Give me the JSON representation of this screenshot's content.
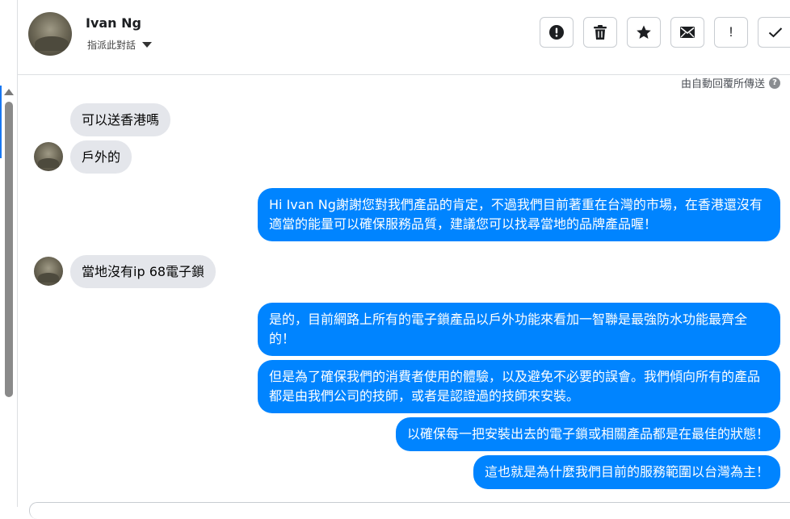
{
  "header": {
    "contact_name": "Ivan Ng",
    "assign_label": "指派此對話",
    "toolbar": [
      {
        "name": "spam-button",
        "icon": "alert-circle-icon"
      },
      {
        "name": "delete-button",
        "icon": "trash-icon"
      },
      {
        "name": "star-button",
        "icon": "star-icon"
      },
      {
        "name": "mark-unread-button",
        "icon": "envelope-icon"
      },
      {
        "name": "follow-up-button",
        "icon": "exclamation-icon",
        "label": "!"
      },
      {
        "name": "done-button",
        "icon": "check-icon"
      }
    ]
  },
  "auto_reply_note": "由自動回覆所傳送",
  "help_glyph": "?",
  "messages": [
    {
      "direction": "in",
      "text": "可以送香港嗎"
    },
    {
      "direction": "in",
      "text": "戶外的"
    },
    {
      "direction": "out",
      "text": "Hi Ivan Ng謝謝您對我們產品的肯定，不過我們目前著重在台灣的市場，在香港還沒有適當的能量可以確保服務品質，建議您可以找尋當地的品牌產品喔！"
    },
    {
      "direction": "in",
      "text": "當地沒有ip 68電子鎖"
    },
    {
      "direction": "out",
      "text": "是的，目前網路上所有的電子鎖產品以戶外功能來看加一智聯是最強防水功能最齊全的！"
    },
    {
      "direction": "out",
      "text": "但是為了確保我們的消費者使用的體驗，以及避免不必要的誤會。我們傾向所有的產品都是由我們公司的技師，或者是認證過的技師來安裝。"
    },
    {
      "direction": "out",
      "text": "以確保每一把安裝出去的電子鎖或相關產品都是在最佳的狀態！"
    },
    {
      "direction": "out",
      "text": "這也就是為什麼我們目前的服務範圍以台灣為主！"
    }
  ],
  "colors": {
    "outgoing_bubble": "#0084ff",
    "incoming_bubble": "#e4e6eb",
    "accent": "#1877f2"
  }
}
